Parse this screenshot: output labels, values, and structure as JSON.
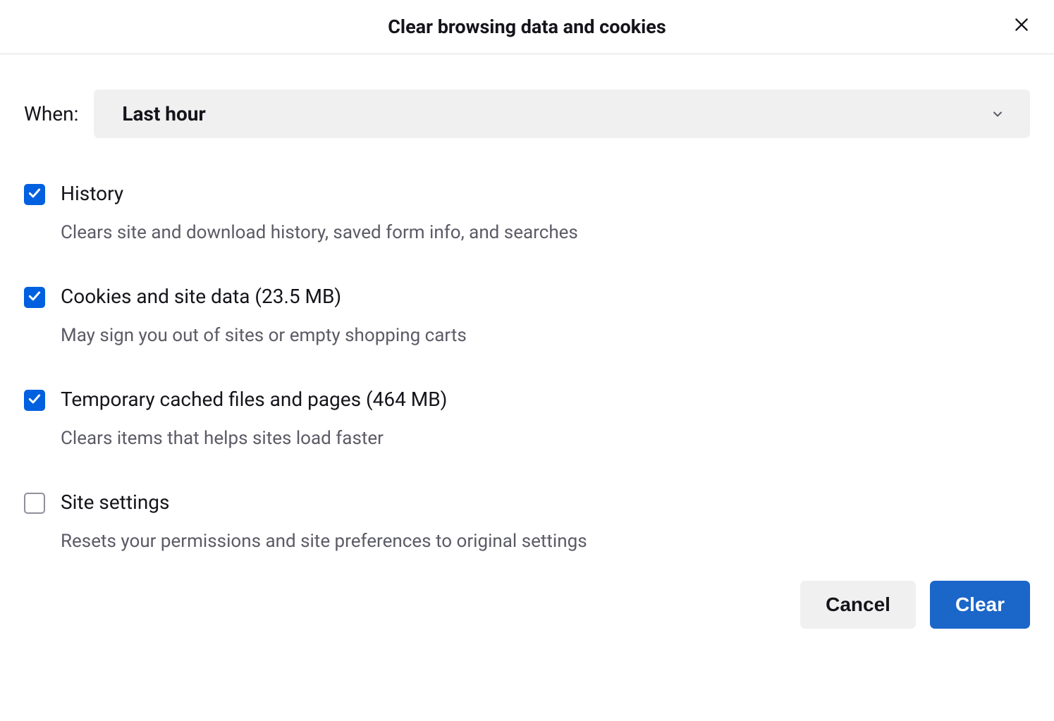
{
  "dialog": {
    "title": "Clear browsing data and cookies",
    "when_label": "When:",
    "time_range_selected": "Last hour",
    "items": [
      {
        "label": "History",
        "description": "Clears site and download history, saved form info, and searches",
        "checked": true
      },
      {
        "label": "Cookies and site data (23.5 MB)",
        "description": "May sign you out of sites or empty shopping carts",
        "checked": true
      },
      {
        "label": "Temporary cached files and pages (464 MB)",
        "description": "Clears items that helps sites load faster",
        "checked": true
      },
      {
        "label": "Site settings",
        "description": "Resets your permissions and site preferences to original settings",
        "checked": false
      }
    ],
    "buttons": {
      "cancel": "Cancel",
      "clear": "Clear"
    }
  }
}
